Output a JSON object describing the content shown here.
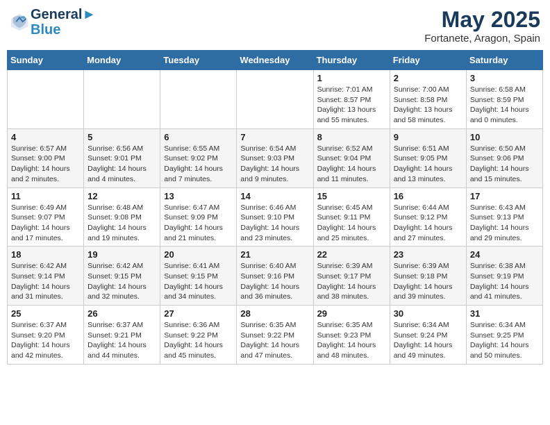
{
  "header": {
    "logo_line1": "General",
    "logo_line2": "Blue",
    "month_year": "May 2025",
    "location": "Fortanete, Aragon, Spain"
  },
  "days_of_week": [
    "Sunday",
    "Monday",
    "Tuesday",
    "Wednesday",
    "Thursday",
    "Friday",
    "Saturday"
  ],
  "weeks": [
    [
      {
        "day": "",
        "info": ""
      },
      {
        "day": "",
        "info": ""
      },
      {
        "day": "",
        "info": ""
      },
      {
        "day": "",
        "info": ""
      },
      {
        "day": "1",
        "info": "Sunrise: 7:01 AM\nSunset: 8:57 PM\nDaylight: 13 hours\nand 55 minutes."
      },
      {
        "day": "2",
        "info": "Sunrise: 7:00 AM\nSunset: 8:58 PM\nDaylight: 13 hours\nand 58 minutes."
      },
      {
        "day": "3",
        "info": "Sunrise: 6:58 AM\nSunset: 8:59 PM\nDaylight: 14 hours\nand 0 minutes."
      }
    ],
    [
      {
        "day": "4",
        "info": "Sunrise: 6:57 AM\nSunset: 9:00 PM\nDaylight: 14 hours\nand 2 minutes."
      },
      {
        "day": "5",
        "info": "Sunrise: 6:56 AM\nSunset: 9:01 PM\nDaylight: 14 hours\nand 4 minutes."
      },
      {
        "day": "6",
        "info": "Sunrise: 6:55 AM\nSunset: 9:02 PM\nDaylight: 14 hours\nand 7 minutes."
      },
      {
        "day": "7",
        "info": "Sunrise: 6:54 AM\nSunset: 9:03 PM\nDaylight: 14 hours\nand 9 minutes."
      },
      {
        "day": "8",
        "info": "Sunrise: 6:52 AM\nSunset: 9:04 PM\nDaylight: 14 hours\nand 11 minutes."
      },
      {
        "day": "9",
        "info": "Sunrise: 6:51 AM\nSunset: 9:05 PM\nDaylight: 14 hours\nand 13 minutes."
      },
      {
        "day": "10",
        "info": "Sunrise: 6:50 AM\nSunset: 9:06 PM\nDaylight: 14 hours\nand 15 minutes."
      }
    ],
    [
      {
        "day": "11",
        "info": "Sunrise: 6:49 AM\nSunset: 9:07 PM\nDaylight: 14 hours\nand 17 minutes."
      },
      {
        "day": "12",
        "info": "Sunrise: 6:48 AM\nSunset: 9:08 PM\nDaylight: 14 hours\nand 19 minutes."
      },
      {
        "day": "13",
        "info": "Sunrise: 6:47 AM\nSunset: 9:09 PM\nDaylight: 14 hours\nand 21 minutes."
      },
      {
        "day": "14",
        "info": "Sunrise: 6:46 AM\nSunset: 9:10 PM\nDaylight: 14 hours\nand 23 minutes."
      },
      {
        "day": "15",
        "info": "Sunrise: 6:45 AM\nSunset: 9:11 PM\nDaylight: 14 hours\nand 25 minutes."
      },
      {
        "day": "16",
        "info": "Sunrise: 6:44 AM\nSunset: 9:12 PM\nDaylight: 14 hours\nand 27 minutes."
      },
      {
        "day": "17",
        "info": "Sunrise: 6:43 AM\nSunset: 9:13 PM\nDaylight: 14 hours\nand 29 minutes."
      }
    ],
    [
      {
        "day": "18",
        "info": "Sunrise: 6:42 AM\nSunset: 9:14 PM\nDaylight: 14 hours\nand 31 minutes."
      },
      {
        "day": "19",
        "info": "Sunrise: 6:42 AM\nSunset: 9:15 PM\nDaylight: 14 hours\nand 32 minutes."
      },
      {
        "day": "20",
        "info": "Sunrise: 6:41 AM\nSunset: 9:15 PM\nDaylight: 14 hours\nand 34 minutes."
      },
      {
        "day": "21",
        "info": "Sunrise: 6:40 AM\nSunset: 9:16 PM\nDaylight: 14 hours\nand 36 minutes."
      },
      {
        "day": "22",
        "info": "Sunrise: 6:39 AM\nSunset: 9:17 PM\nDaylight: 14 hours\nand 38 minutes."
      },
      {
        "day": "23",
        "info": "Sunrise: 6:39 AM\nSunset: 9:18 PM\nDaylight: 14 hours\nand 39 minutes."
      },
      {
        "day": "24",
        "info": "Sunrise: 6:38 AM\nSunset: 9:19 PM\nDaylight: 14 hours\nand 41 minutes."
      }
    ],
    [
      {
        "day": "25",
        "info": "Sunrise: 6:37 AM\nSunset: 9:20 PM\nDaylight: 14 hours\nand 42 minutes."
      },
      {
        "day": "26",
        "info": "Sunrise: 6:37 AM\nSunset: 9:21 PM\nDaylight: 14 hours\nand 44 minutes."
      },
      {
        "day": "27",
        "info": "Sunrise: 6:36 AM\nSunset: 9:22 PM\nDaylight: 14 hours\nand 45 minutes."
      },
      {
        "day": "28",
        "info": "Sunrise: 6:35 AM\nSunset: 9:22 PM\nDaylight: 14 hours\nand 47 minutes."
      },
      {
        "day": "29",
        "info": "Sunrise: 6:35 AM\nSunset: 9:23 PM\nDaylight: 14 hours\nand 48 minutes."
      },
      {
        "day": "30",
        "info": "Sunrise: 6:34 AM\nSunset: 9:24 PM\nDaylight: 14 hours\nand 49 minutes."
      },
      {
        "day": "31",
        "info": "Sunrise: 6:34 AM\nSunset: 9:25 PM\nDaylight: 14 hours\nand 50 minutes."
      }
    ]
  ]
}
